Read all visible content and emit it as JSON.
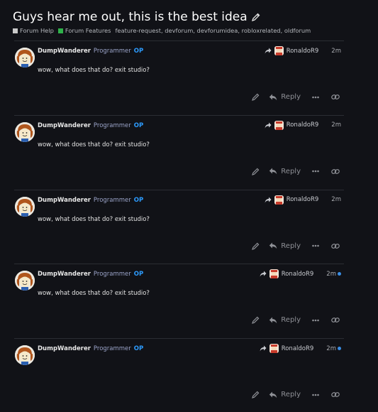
{
  "topic": {
    "title": "Guys hear me out, this is the best idea",
    "categories": [
      {
        "label": "Forum Help",
        "color": "#c9c9c9"
      },
      {
        "label": "Forum Features",
        "color": "#2fb24a"
      }
    ],
    "tags": "feature-request, devforum, devforumidea, robloxrelated, oldforum"
  },
  "posts": [
    {
      "username": "DumpWanderer",
      "rank": "Programmer",
      "badge": "OP",
      "reply_to": "RonaldoR9",
      "time": "2m",
      "text": "wow, what does that do? exit studio?",
      "unread": false
    },
    {
      "username": "DumpWanderer",
      "rank": "Programmer",
      "badge": "OP",
      "reply_to": "RonaldoR9",
      "time": "2m",
      "text": "wow, what does that do? exit studio?",
      "unread": false
    },
    {
      "username": "DumpWanderer",
      "rank": "Programmer",
      "badge": "OP",
      "reply_to": "RonaldoR9",
      "time": "2m",
      "text": "wow, what does that do? exit studio?",
      "unread": false
    },
    {
      "username": "DumpWanderer",
      "rank": "Programmer",
      "badge": "OP",
      "reply_to": "RonaldoR9",
      "time": "2m",
      "text": "wow, what does that do? exit studio?",
      "unread": true
    },
    {
      "username": "DumpWanderer",
      "rank": "Programmer",
      "badge": "OP",
      "reply_to": "RonaldoR9",
      "time": "2m",
      "text": "",
      "unread": true
    }
  ],
  "actions": {
    "reply_label": "Reply"
  },
  "icons": {
    "edit": "pencil-icon",
    "reply": "reply-arrow-icon",
    "more": "ellipsis-icon",
    "link": "link-icon",
    "reply_to": "share-arrow-icon"
  }
}
